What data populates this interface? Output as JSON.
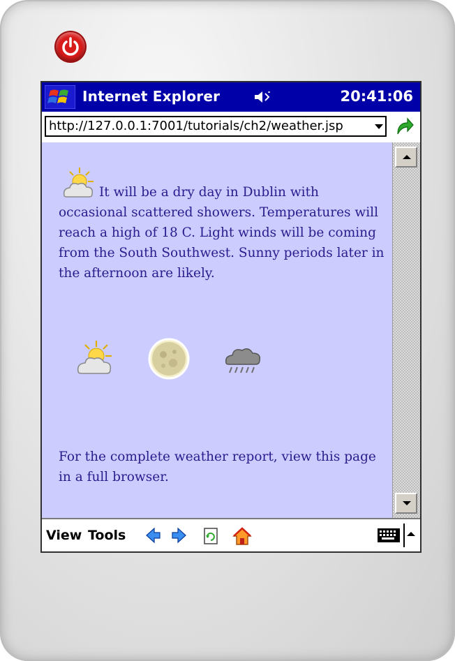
{
  "window": {
    "app_title": "Internet Explorer",
    "clock": "20:41:06"
  },
  "address_bar": {
    "url": "http://127.0.0.1:7001/tutorials/ch2/weather.jsp"
  },
  "content": {
    "forecast": "It will be a dry day in Dublin with occasional scattered showers. Temperatures will reach a high of 18 C. Light winds will be coming from the South Southwest. Sunny periods later in the afternoon are likely.",
    "footer": "For the complete weather report, view this page in a full browser.",
    "weather_icons": [
      "partly-sunny-icon",
      "moon-icon",
      "rain-cloud-icon"
    ]
  },
  "menubar": {
    "view_label": "View",
    "tools_label": "Tools"
  },
  "colors": {
    "titlebar": "#0000a8",
    "page_background": "#ccccff",
    "text": "#2a1c8c",
    "power_button": "#d81b1b"
  }
}
